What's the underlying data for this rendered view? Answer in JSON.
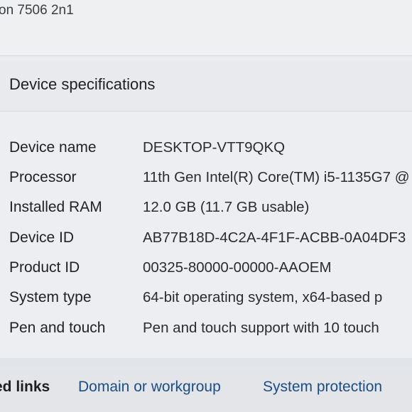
{
  "header": {
    "device_model_fragment": "on 7506 2n1"
  },
  "device_specifications": {
    "title": "Device specifications",
    "rows": [
      {
        "label": "Device name",
        "value": "DESKTOP-VTT9QKQ"
      },
      {
        "label": "Processor",
        "value": "11th Gen Intel(R) Core(TM) i5-1135G7 @"
      },
      {
        "label": "Installed RAM",
        "value": "12.0 GB (11.7 GB usable)"
      },
      {
        "label": "Device ID",
        "value": "AB77B18D-4C2A-4F1F-ACBB-0A04DF3"
      },
      {
        "label": "Product ID",
        "value": "00325-80000-00000-AAOEM"
      },
      {
        "label": "System type",
        "value": "64-bit operating system, x64-based p"
      },
      {
        "label": "Pen and touch",
        "value": "Pen and touch support with 10 touch"
      }
    ]
  },
  "related_links": {
    "label": "ed links",
    "links": [
      {
        "label": "Domain or workgroup"
      },
      {
        "label": "System protection"
      }
    ]
  }
}
